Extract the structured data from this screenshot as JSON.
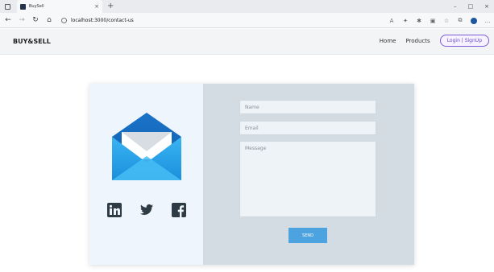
{
  "browser": {
    "tab_title": "BuySell",
    "tab_close": "×",
    "new_tab": "+",
    "url": "localhost:3000/contact-us",
    "window_controls": [
      "–",
      "□",
      "×"
    ]
  },
  "navbar": {
    "brand": "BUY&SELL",
    "links": [
      "Home",
      "Products"
    ],
    "login_label": "Login | SignUp"
  },
  "contact": {
    "name_placeholder": "Name",
    "email_placeholder": "Email",
    "message_placeholder": "Message",
    "send_label": "SEND"
  },
  "icons": {
    "envelope": "envelope-icon",
    "linkedin": "linkedin-icon",
    "twitter": "twitter-icon",
    "facebook": "facebook-icon"
  },
  "colors": {
    "send_button": "#4da3e0",
    "login_border": "#7b5cd6",
    "card_left_bg": "#eef5fc",
    "card_right_bg": "#d3dbe3"
  }
}
